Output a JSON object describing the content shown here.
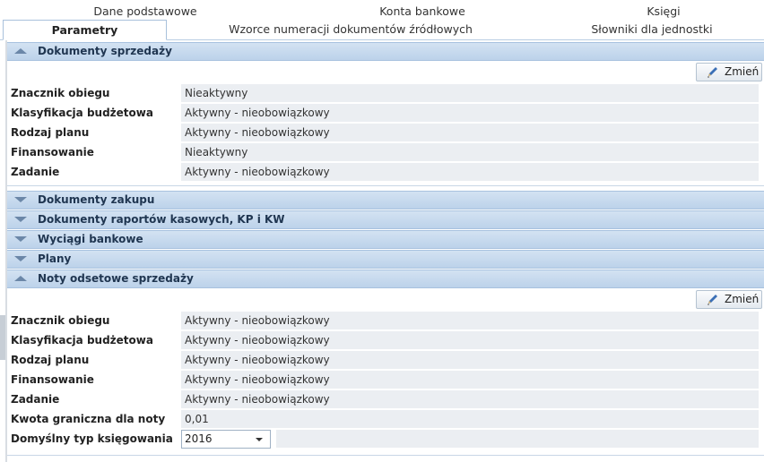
{
  "tabs": {
    "row1": [
      "Dane podstawowe",
      "Konta bankowe",
      "Księgi"
    ],
    "row2": [
      "Parametry",
      "Wzorce numeracji dokumentów źródłowych",
      "Słowniki dla jednostki"
    ]
  },
  "panels": {
    "sales": {
      "title": "Dokumenty sprzedaży",
      "change_label": "Zmień",
      "rows": [
        {
          "label": "Znacznik obiegu",
          "value": "Nieaktywny"
        },
        {
          "label": "Klasyfikacja budżetowa",
          "value": "Aktywny - nieobowiązkowy"
        },
        {
          "label": "Rodzaj planu",
          "value": "Aktywny - nieobowiązkowy"
        },
        {
          "label": "Finansowanie",
          "value": "Nieaktywny"
        },
        {
          "label": "Zadanie",
          "value": "Aktywny - nieobowiązkowy"
        }
      ]
    },
    "collapsed": [
      "Dokumenty zakupu",
      "Dokumenty raportów kasowych, KP i KW",
      "Wyciągi bankowe",
      "Plany"
    ],
    "interest_notes": {
      "title": "Noty odsetowe sprzedaży",
      "change_label": "Zmień",
      "rows": [
        {
          "label": "Znacznik obiegu",
          "value": "Aktywny - nieobowiązkowy"
        },
        {
          "label": "Klasyfikacja budżetowa",
          "value": "Aktywny - nieobowiązkowy"
        },
        {
          "label": "Rodzaj planu",
          "value": "Aktywny - nieobowiązkowy"
        },
        {
          "label": "Finansowanie",
          "value": "Aktywny - nieobowiązkowy"
        },
        {
          "label": "Zadanie",
          "value": "Aktywny - nieobowiązkowy"
        },
        {
          "label": "Kwota graniczna dla noty",
          "value": "0,01"
        }
      ],
      "posting_type": {
        "label": "Domyślny typ księgowania",
        "value": "2016"
      }
    }
  }
}
